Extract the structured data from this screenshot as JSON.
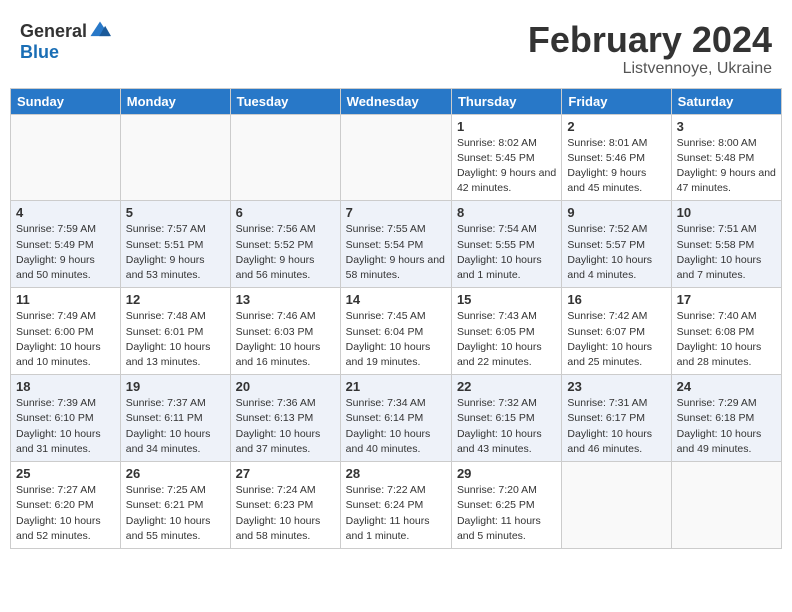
{
  "header": {
    "logo_general": "General",
    "logo_blue": "Blue",
    "month_title": "February 2024",
    "subtitle": "Listvennoye, Ukraine"
  },
  "weekdays": [
    "Sunday",
    "Monday",
    "Tuesday",
    "Wednesday",
    "Thursday",
    "Friday",
    "Saturday"
  ],
  "weeks": [
    [
      {
        "day": "",
        "sunrise": "",
        "sunset": "",
        "daylight": ""
      },
      {
        "day": "",
        "sunrise": "",
        "sunset": "",
        "daylight": ""
      },
      {
        "day": "",
        "sunrise": "",
        "sunset": "",
        "daylight": ""
      },
      {
        "day": "",
        "sunrise": "",
        "sunset": "",
        "daylight": ""
      },
      {
        "day": "1",
        "sunrise": "Sunrise: 8:02 AM",
        "sunset": "Sunset: 5:45 PM",
        "daylight": "Daylight: 9 hours and 42 minutes."
      },
      {
        "day": "2",
        "sunrise": "Sunrise: 8:01 AM",
        "sunset": "Sunset: 5:46 PM",
        "daylight": "Daylight: 9 hours and 45 minutes."
      },
      {
        "day": "3",
        "sunrise": "Sunrise: 8:00 AM",
        "sunset": "Sunset: 5:48 PM",
        "daylight": "Daylight: 9 hours and 47 minutes."
      }
    ],
    [
      {
        "day": "4",
        "sunrise": "Sunrise: 7:59 AM",
        "sunset": "Sunset: 5:49 PM",
        "daylight": "Daylight: 9 hours and 50 minutes."
      },
      {
        "day": "5",
        "sunrise": "Sunrise: 7:57 AM",
        "sunset": "Sunset: 5:51 PM",
        "daylight": "Daylight: 9 hours and 53 minutes."
      },
      {
        "day": "6",
        "sunrise": "Sunrise: 7:56 AM",
        "sunset": "Sunset: 5:52 PM",
        "daylight": "Daylight: 9 hours and 56 minutes."
      },
      {
        "day": "7",
        "sunrise": "Sunrise: 7:55 AM",
        "sunset": "Sunset: 5:54 PM",
        "daylight": "Daylight: 9 hours and 58 minutes."
      },
      {
        "day": "8",
        "sunrise": "Sunrise: 7:54 AM",
        "sunset": "Sunset: 5:55 PM",
        "daylight": "Daylight: 10 hours and 1 minute."
      },
      {
        "day": "9",
        "sunrise": "Sunrise: 7:52 AM",
        "sunset": "Sunset: 5:57 PM",
        "daylight": "Daylight: 10 hours and 4 minutes."
      },
      {
        "day": "10",
        "sunrise": "Sunrise: 7:51 AM",
        "sunset": "Sunset: 5:58 PM",
        "daylight": "Daylight: 10 hours and 7 minutes."
      }
    ],
    [
      {
        "day": "11",
        "sunrise": "Sunrise: 7:49 AM",
        "sunset": "Sunset: 6:00 PM",
        "daylight": "Daylight: 10 hours and 10 minutes."
      },
      {
        "day": "12",
        "sunrise": "Sunrise: 7:48 AM",
        "sunset": "Sunset: 6:01 PM",
        "daylight": "Daylight: 10 hours and 13 minutes."
      },
      {
        "day": "13",
        "sunrise": "Sunrise: 7:46 AM",
        "sunset": "Sunset: 6:03 PM",
        "daylight": "Daylight: 10 hours and 16 minutes."
      },
      {
        "day": "14",
        "sunrise": "Sunrise: 7:45 AM",
        "sunset": "Sunset: 6:04 PM",
        "daylight": "Daylight: 10 hours and 19 minutes."
      },
      {
        "day": "15",
        "sunrise": "Sunrise: 7:43 AM",
        "sunset": "Sunset: 6:05 PM",
        "daylight": "Daylight: 10 hours and 22 minutes."
      },
      {
        "day": "16",
        "sunrise": "Sunrise: 7:42 AM",
        "sunset": "Sunset: 6:07 PM",
        "daylight": "Daylight: 10 hours and 25 minutes."
      },
      {
        "day": "17",
        "sunrise": "Sunrise: 7:40 AM",
        "sunset": "Sunset: 6:08 PM",
        "daylight": "Daylight: 10 hours and 28 minutes."
      }
    ],
    [
      {
        "day": "18",
        "sunrise": "Sunrise: 7:39 AM",
        "sunset": "Sunset: 6:10 PM",
        "daylight": "Daylight: 10 hours and 31 minutes."
      },
      {
        "day": "19",
        "sunrise": "Sunrise: 7:37 AM",
        "sunset": "Sunset: 6:11 PM",
        "daylight": "Daylight: 10 hours and 34 minutes."
      },
      {
        "day": "20",
        "sunrise": "Sunrise: 7:36 AM",
        "sunset": "Sunset: 6:13 PM",
        "daylight": "Daylight: 10 hours and 37 minutes."
      },
      {
        "day": "21",
        "sunrise": "Sunrise: 7:34 AM",
        "sunset": "Sunset: 6:14 PM",
        "daylight": "Daylight: 10 hours and 40 minutes."
      },
      {
        "day": "22",
        "sunrise": "Sunrise: 7:32 AM",
        "sunset": "Sunset: 6:15 PM",
        "daylight": "Daylight: 10 hours and 43 minutes."
      },
      {
        "day": "23",
        "sunrise": "Sunrise: 7:31 AM",
        "sunset": "Sunset: 6:17 PM",
        "daylight": "Daylight: 10 hours and 46 minutes."
      },
      {
        "day": "24",
        "sunrise": "Sunrise: 7:29 AM",
        "sunset": "Sunset: 6:18 PM",
        "daylight": "Daylight: 10 hours and 49 minutes."
      }
    ],
    [
      {
        "day": "25",
        "sunrise": "Sunrise: 7:27 AM",
        "sunset": "Sunset: 6:20 PM",
        "daylight": "Daylight: 10 hours and 52 minutes."
      },
      {
        "day": "26",
        "sunrise": "Sunrise: 7:25 AM",
        "sunset": "Sunset: 6:21 PM",
        "daylight": "Daylight: 10 hours and 55 minutes."
      },
      {
        "day": "27",
        "sunrise": "Sunrise: 7:24 AM",
        "sunset": "Sunset: 6:23 PM",
        "daylight": "Daylight: 10 hours and 58 minutes."
      },
      {
        "day": "28",
        "sunrise": "Sunrise: 7:22 AM",
        "sunset": "Sunset: 6:24 PM",
        "daylight": "Daylight: 11 hours and 1 minute."
      },
      {
        "day": "29",
        "sunrise": "Sunrise: 7:20 AM",
        "sunset": "Sunset: 6:25 PM",
        "daylight": "Daylight: 11 hours and 5 minutes."
      },
      {
        "day": "",
        "sunrise": "",
        "sunset": "",
        "daylight": ""
      },
      {
        "day": "",
        "sunrise": "",
        "sunset": "",
        "daylight": ""
      }
    ]
  ]
}
